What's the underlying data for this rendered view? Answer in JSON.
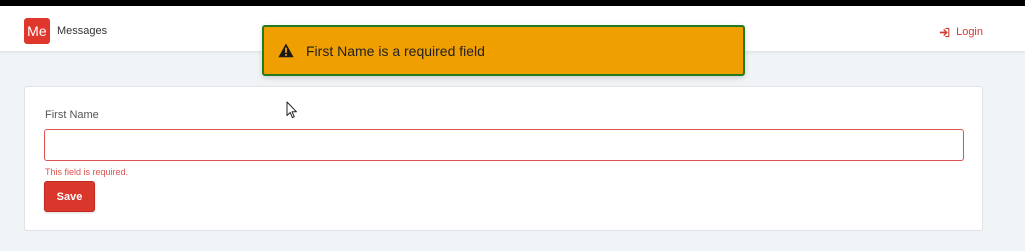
{
  "brand": {
    "logo_text": "Me",
    "name": "Messages"
  },
  "nav": {
    "login_label": "Login",
    "login_icon": "sign-in-icon"
  },
  "toast": {
    "icon": "warning-icon",
    "message": "First Name is a required field",
    "background": "#f09f00",
    "border": "#237a21"
  },
  "form": {
    "first_name_label": "First Name",
    "first_name_value": "",
    "first_name_error": "This field is required.",
    "save_label": "Save"
  },
  "colors": {
    "accent": "#e0372c",
    "error": "#d9534f"
  }
}
